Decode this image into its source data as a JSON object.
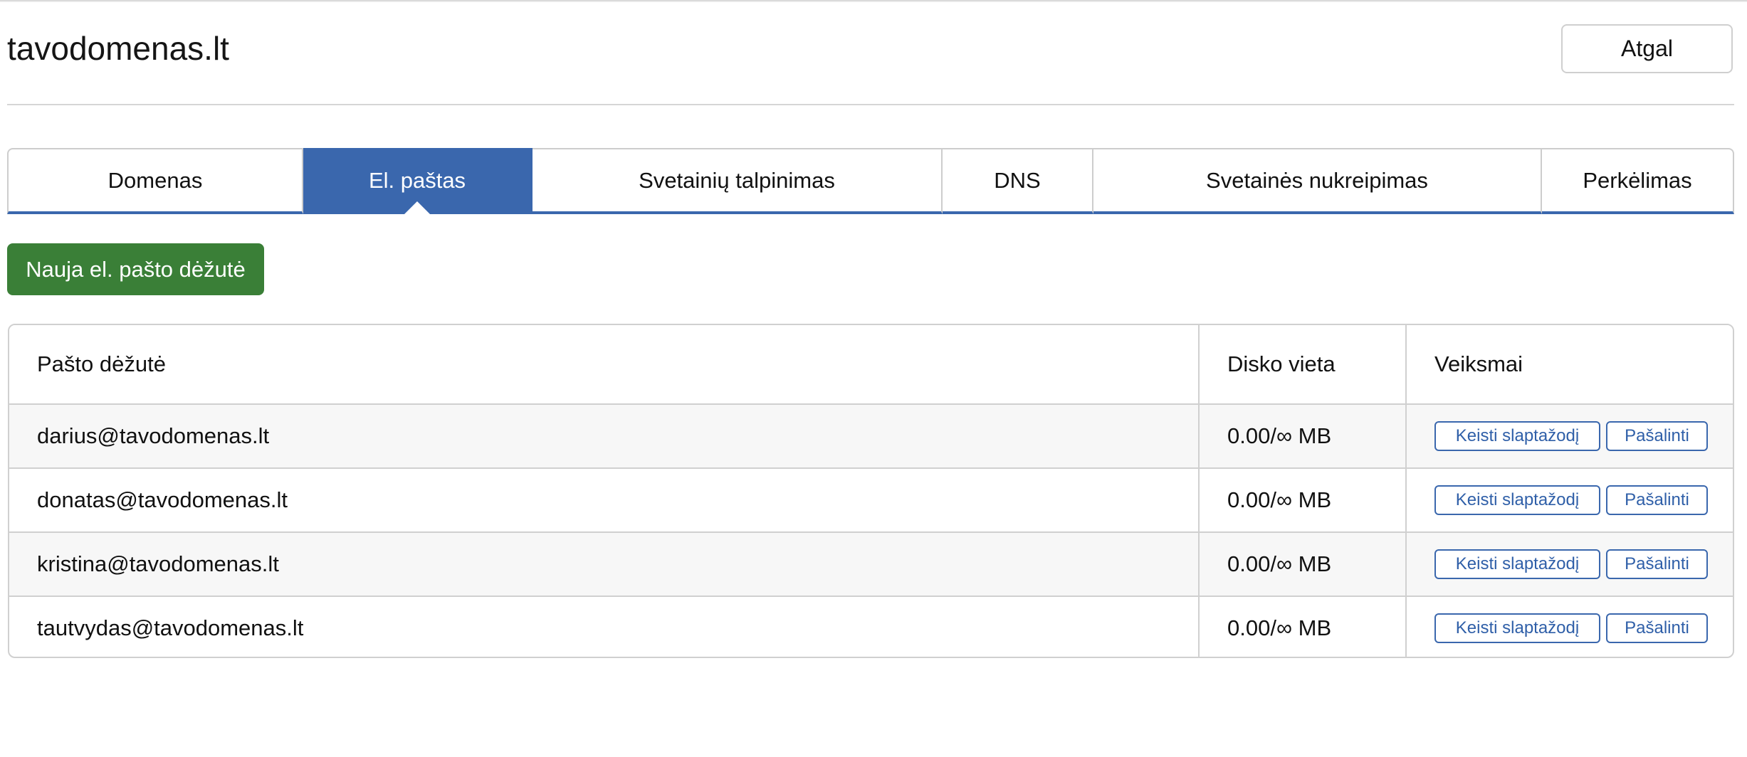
{
  "header": {
    "title": "tavodomenas.lt",
    "back_label": "Atgal"
  },
  "tabs": [
    {
      "label": "Domenas",
      "active": false
    },
    {
      "label": "El. paštas",
      "active": true
    },
    {
      "label": "Svetainių talpinimas",
      "active": false
    },
    {
      "label": "DNS",
      "active": false
    },
    {
      "label": "Svetainės nukreipimas",
      "active": false
    },
    {
      "label": "Perkėlimas",
      "active": false
    }
  ],
  "new_mailbox_label": "Nauja el. pašto dėžutė",
  "table": {
    "headers": [
      "Pašto dėžutė",
      "Disko vieta",
      "Veiksmai"
    ],
    "rows": [
      {
        "mailbox": "darius@tavodomenas.lt",
        "disk": "0.00/∞ MB"
      },
      {
        "mailbox": "donatas@tavodomenas.lt",
        "disk": "0.00/∞ MB"
      },
      {
        "mailbox": "kristina@tavodomenas.lt",
        "disk": "0.00/∞ MB"
      },
      {
        "mailbox": "tautvydas@tavodomenas.lt",
        "disk": "0.00/∞ MB"
      }
    ],
    "actions": {
      "change_password": "Keisti slaptažodį",
      "remove": "Pašalinti"
    }
  },
  "colors": {
    "primary": "#3a67ad",
    "success": "#3a7f37"
  }
}
